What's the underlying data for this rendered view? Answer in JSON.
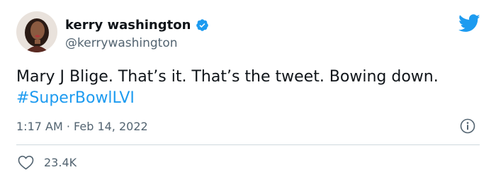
{
  "author": {
    "display_name": "kerry washington",
    "handle": "@kerrywashington",
    "verified": true
  },
  "tweet": {
    "text": "Mary J Blige. That’s it. That’s the tweet. Bowing down. ",
    "hashtag": "#SuperBowlLVI"
  },
  "meta": {
    "time": "1:17 AM",
    "separator": " · ",
    "date": "Feb 14, 2022"
  },
  "stats": {
    "likes": "23.4K"
  },
  "icons": {
    "logo": "twitter-bird-icon",
    "verified": "verified-badge-icon",
    "info": "info-icon",
    "like": "heart-icon"
  },
  "colors": {
    "brand": "#1d9bf0",
    "text": "#0f1419",
    "secondary": "#536471",
    "divider": "#cfd9de"
  }
}
